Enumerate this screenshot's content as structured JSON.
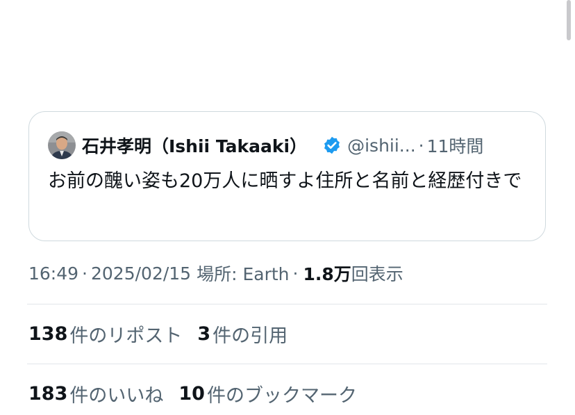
{
  "quote": {
    "author_name": "石井孝明（Ishii Takaaki）",
    "verified_icon": "verified-badge-icon",
    "handle": "@ishii...",
    "separator": "·",
    "time": "11時間",
    "text": "お前の醜い姿も20万人に晒すよ住所と名前と経歴付きで"
  },
  "meta": {
    "time": "16:49",
    "dot1": "·",
    "date": "2025/02/15",
    "location": "場所: Earth",
    "dot2": "·",
    "views_count": "1.8万",
    "views_label": "回表示"
  },
  "stats": {
    "reposts_count": "138",
    "reposts_label": "件のリポスト",
    "quotes_count": "3",
    "quotes_label": "件の引用",
    "likes_count": "183",
    "likes_label": "件のいいね",
    "bookmarks_count": "10",
    "bookmarks_label": "件のブックマーク"
  },
  "colors": {
    "text_primary": "#0f1419",
    "text_secondary": "#536471",
    "border": "#cfd9de",
    "verified_blue": "#1d9bf0"
  }
}
